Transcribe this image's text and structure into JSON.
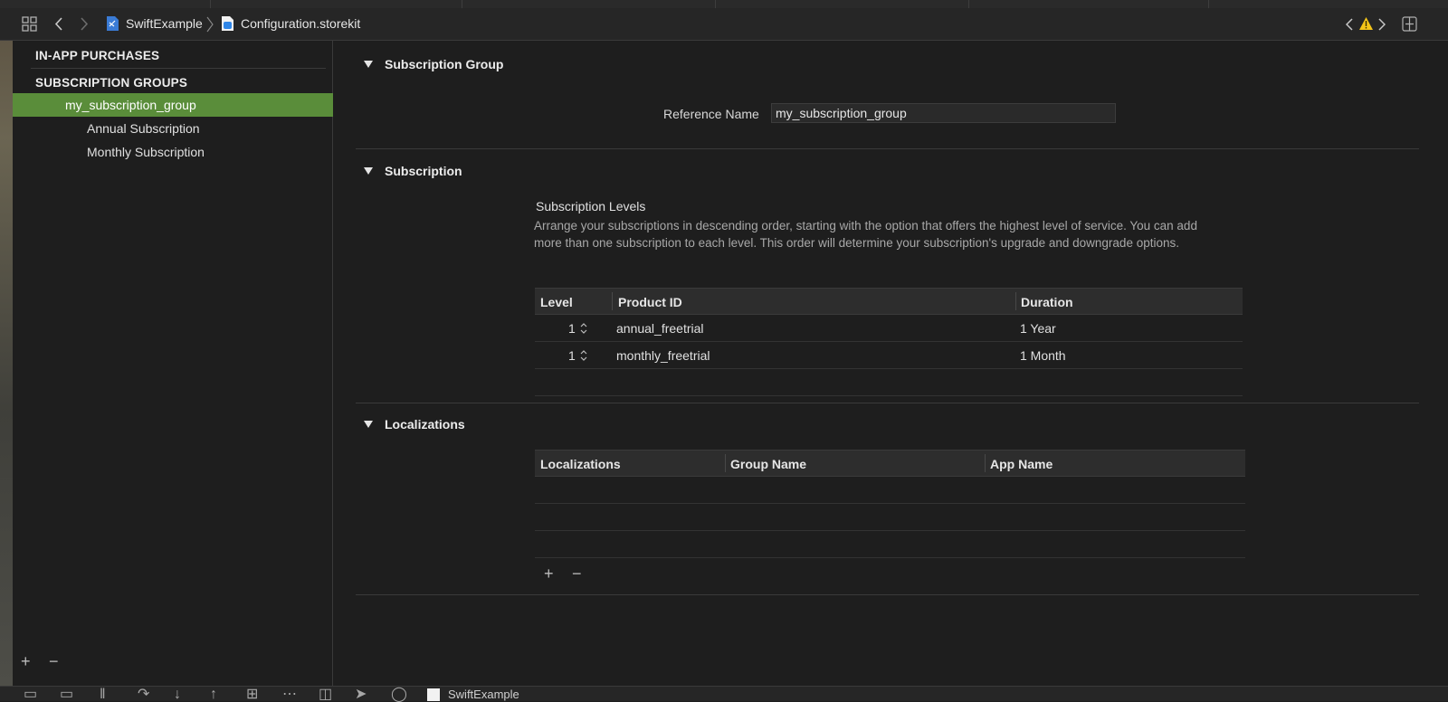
{
  "window": {
    "breadcrumb": {
      "project": "SwiftExample",
      "file": "Configuration.storekit"
    },
    "icons": [
      "grid-icon",
      "back-icon",
      "forward-icon",
      "project-file-icon",
      "storekit-file-icon",
      "warning-icon",
      "add-editor-icon"
    ]
  },
  "sidebar": {
    "sections": [
      {
        "header": "IN-APP PURCHASES"
      },
      {
        "header": "SUBSCRIPTION GROUPS"
      }
    ],
    "group": "my_subscription_group",
    "items": [
      "Annual Subscription",
      "Monthly Subscription"
    ],
    "footer": {
      "add": "+",
      "remove": "−"
    }
  },
  "main": {
    "subscription_group": {
      "title": "Subscription Group",
      "reference_name_label": "Reference Name",
      "reference_name_value": "my_subscription_group"
    },
    "subscription": {
      "title": "Subscription",
      "levels_title": "Subscription Levels",
      "description": "Arrange your subscriptions in descending order, starting with the option that offers the highest level of service.  You can add more than one subscription to each level.  This order will determine your subscription's upgrade and downgrade options.",
      "columns": [
        "Level",
        "Product ID",
        "Duration"
      ],
      "rows": [
        {
          "level": "1",
          "product_id": "annual_freetrial",
          "duration": "1 Year"
        },
        {
          "level": "1",
          "product_id": "monthly_freetrial",
          "duration": "1 Month"
        }
      ]
    },
    "localizations": {
      "title": "Localizations",
      "columns": [
        "Localizations",
        "Group Name",
        "App Name"
      ],
      "add": "+",
      "remove": "−"
    }
  },
  "statusbar": {
    "scheme": "SwiftExample"
  },
  "colors": {
    "background": "#1e1e1e",
    "selection": "#5a8d3a",
    "warning": "#f5c518"
  }
}
